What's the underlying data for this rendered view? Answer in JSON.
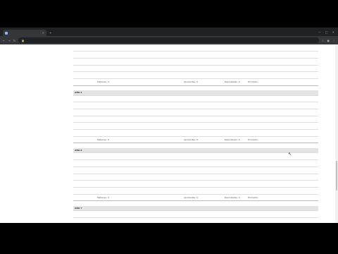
{
  "browser": {
    "tab_title": "",
    "url": "",
    "tab_close": "×",
    "new_tab": "+",
    "minimize": "—",
    "maximize": "□",
    "close": "✕"
  },
  "table": {
    "sections": [
      {
        "title": "",
        "summary": {
          "label": "Materias: 9",
          "aprobadas": "Aprobadas: 9",
          "reprobadas": "Reprobadas: 0",
          "promedio": "Promedio: "
        }
      },
      {
        "title": "AÑO 4",
        "summary": {
          "label": "Materias: 9",
          "aprobadas": "Aprobadas: 9",
          "reprobadas": "Reprobadas: 0",
          "promedio": "Promedio: "
        }
      },
      {
        "title": "AÑO 6",
        "summary": {
          "label": "Materias: 9",
          "aprobadas": "Aprobadas: 9",
          "reprobadas": "Reprobadas: 0",
          "promedio": "Promedio: "
        }
      },
      {
        "title": "AÑO 7",
        "summary": null
      }
    ]
  }
}
